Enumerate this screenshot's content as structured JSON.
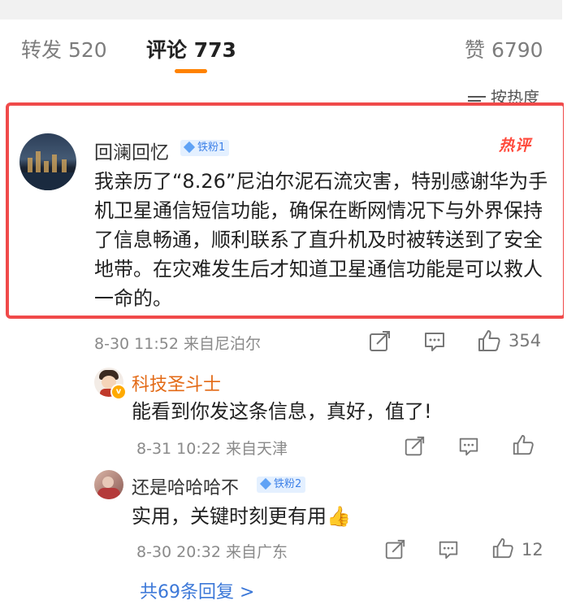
{
  "tabs": [
    {
      "label": "转发 520"
    },
    {
      "label": "评论 773"
    },
    {
      "label": "赞 6790"
    }
  ],
  "sort": {
    "label": "按热度"
  },
  "comment": {
    "username": "回澜回忆",
    "badge": "铁粉1",
    "hot_label": "热评",
    "text": "我亲历了“8.26”尼泊尔泥石流灾害，特别感谢华为手机卫星通信短信功能，确保在断网情况下与外界保持了信息畅通，顺利联系了直升机及时被转送到了安全地带。在灾难发生后才知道卫星通信功能是可以救人一命的。",
    "meta": "8-30 11:52 来自尼泊尔",
    "like_count": "354"
  },
  "replies": [
    {
      "username": "科技圣斗士",
      "verified_badge": "v",
      "text": "能看到你发这条信息，真好，值了!",
      "meta": "8-31 10:22 来自天津",
      "like_count": ""
    },
    {
      "username": "还是哈哈哈不",
      "badge": "铁粉2",
      "text": "实用，关键时刻更有用👍",
      "meta": "8-30 20:32 来自广东",
      "like_count": "12"
    }
  ],
  "more_replies": "共69条回复 >",
  "colors": {
    "accent": "#ff8200",
    "highlight_border": "#f04a4a",
    "link": "#3c78d8",
    "username_orange": "#e36a16",
    "badge_blue": "#3f82e8"
  }
}
